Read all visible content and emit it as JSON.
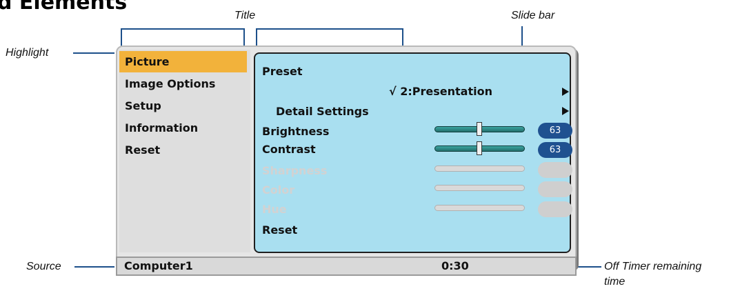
{
  "heading": "d Elements",
  "callouts": {
    "title": "Title",
    "slide_bar": "Slide bar",
    "highlight": "Highlight",
    "source": "Source",
    "off_timer_line1": "Off Timer remaining",
    "off_timer_line2": "time"
  },
  "menu": {
    "items": [
      {
        "label": "Picture",
        "selected": true
      },
      {
        "label": "Image Options"
      },
      {
        "label": "Setup"
      },
      {
        "label": "Information"
      },
      {
        "label": "Reset"
      }
    ]
  },
  "panel": {
    "preset_label": "Preset",
    "preset_value": "√ 2:Presentation",
    "detail_settings_label": "Detail Settings",
    "brightness": {
      "label": "Brightness",
      "value": "63",
      "level": 0.63,
      "enabled": true
    },
    "contrast": {
      "label": "Contrast",
      "value": "63",
      "level": 0.63,
      "enabled": true
    },
    "sharpness": {
      "label": "Sharpness",
      "enabled": false
    },
    "color": {
      "label": "Color",
      "enabled": false
    },
    "hue": {
      "label": "Hue",
      "enabled": false
    },
    "reset_label": "Reset"
  },
  "status": {
    "source": "Computer1",
    "off_timer": "0:30"
  },
  "colors": {
    "highlight": "#f2b23b",
    "panel_bg": "#a9dff0",
    "callout_line": "#1c4f8a",
    "value_pill": "#1f5190"
  }
}
